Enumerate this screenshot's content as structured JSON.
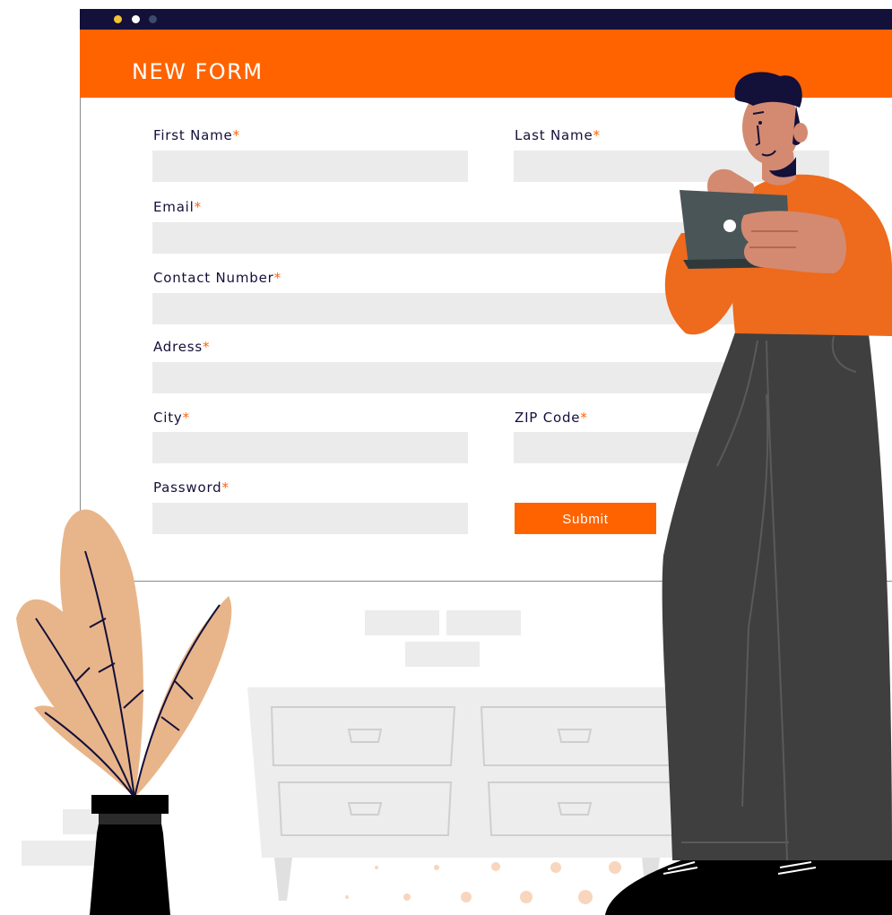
{
  "window": {
    "title_dots": [
      "#f4c430",
      "#ffffff",
      "#3b4b6a"
    ]
  },
  "form": {
    "title": "NEW FORM",
    "required_mark": "*",
    "first_name": {
      "label": "First Name",
      "value": ""
    },
    "last_name": {
      "label": "Last Name",
      "value": ""
    },
    "email": {
      "label": "Email",
      "value": ""
    },
    "contact_number": {
      "label": "Contact Number",
      "value": ""
    },
    "address": {
      "label": "Adress",
      "value": ""
    },
    "city": {
      "label": "City",
      "value": ""
    },
    "zip_code": {
      "label": "ZIP Code",
      "value": ""
    },
    "password": {
      "label": "Password",
      "value": ""
    },
    "submit_label": "Submit"
  },
  "colors": {
    "accent": "#ff6300",
    "titlebar": "#13103a",
    "text": "#13103a",
    "field": "#ebebeb",
    "plant": "#e8b58a",
    "pants": "#3f3f3f",
    "tablet": "#4a5558"
  },
  "illustration": {
    "icons": [
      "potted-plant-icon",
      "cabinet-icon",
      "person-with-tablet-icon"
    ]
  }
}
